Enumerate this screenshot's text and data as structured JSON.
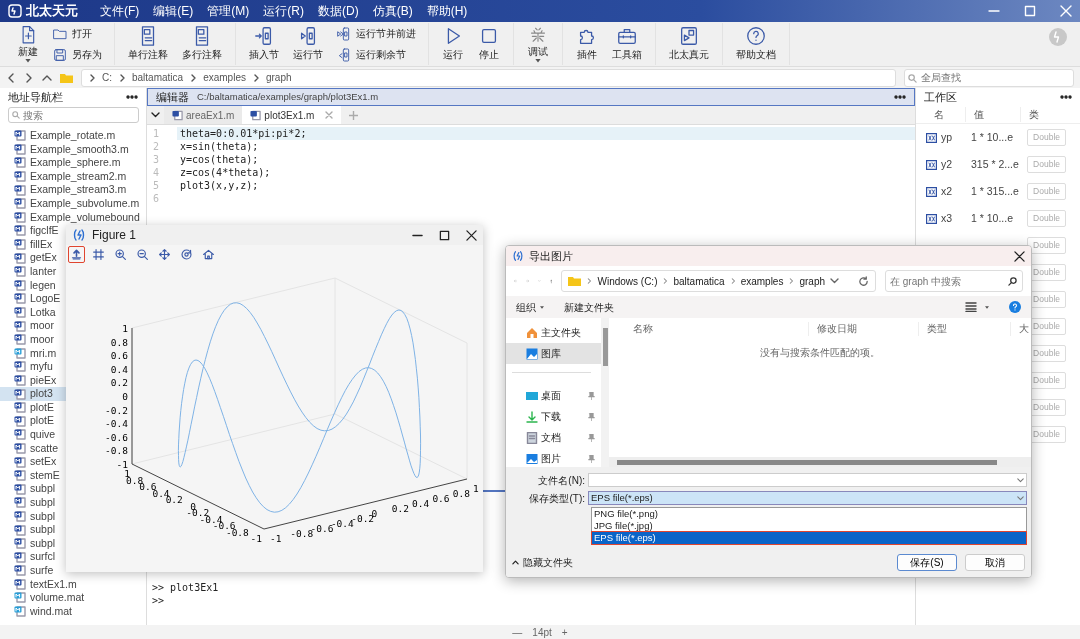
{
  "title_bar": {
    "app_name": "北太天元",
    "menus": [
      "文件(F)",
      "编辑(E)",
      "管理(M)",
      "运行(R)",
      "数据(D)",
      "仿真(B)",
      "帮助(H)"
    ]
  },
  "toolbar": {
    "groups": [
      {
        "items": [
          {
            "kind": "large",
            "label": "新建",
            "dropdown": true
          },
          {
            "kind": "stack",
            "labels": [
              "打开",
              "另存为"
            ]
          }
        ]
      },
      {
        "items": [
          {
            "kind": "large",
            "label": "单行注释",
            "dropdown": false
          },
          {
            "kind": "large",
            "label": "多行注释",
            "dropdown": false
          }
        ]
      },
      {
        "items": [
          {
            "kind": "large",
            "label": "插入节",
            "dropdown": false
          },
          {
            "kind": "large",
            "label": "运行节",
            "dropdown": false
          },
          {
            "kind": "stack",
            "labels": [
              "运行节并前进",
              "运行剩余节"
            ]
          }
        ]
      },
      {
        "items": [
          {
            "kind": "large",
            "label": "运行",
            "dropdown": false
          },
          {
            "kind": "large",
            "label": "停止",
            "dropdown": false
          }
        ]
      },
      {
        "items": [
          {
            "kind": "large",
            "label": "调试",
            "dropdown": true
          }
        ]
      },
      {
        "items": [
          {
            "kind": "large",
            "label": "插件",
            "dropdown": false
          },
          {
            "kind": "large",
            "label": "工具箱",
            "dropdown": false
          }
        ]
      },
      {
        "items": [
          {
            "kind": "large",
            "label": "北太真元",
            "dropdown": false
          }
        ]
      },
      {
        "items": [
          {
            "kind": "large",
            "label": "帮助文档",
            "dropdown": false
          }
        ]
      }
    ]
  },
  "address_bar": {
    "path": [
      "C:",
      "baltamatica",
      "examples",
      "graph"
    ],
    "search_placeholder": "全局查找"
  },
  "navigator": {
    "title": "地址导航栏",
    "search_placeholder": "搜索",
    "files": [
      {
        "name": "Example_rotate.m",
        "kind": "script",
        "selected": false
      },
      {
        "name": "Example_smooth3.m",
        "kind": "script",
        "selected": false
      },
      {
        "name": "Example_sphere.m",
        "kind": "script",
        "selected": false
      },
      {
        "name": "Example_stream2.m",
        "kind": "script",
        "selected": false
      },
      {
        "name": "Example_stream3.m",
        "kind": "script",
        "selected": false
      },
      {
        "name": "Example_subvolume.m",
        "kind": "script",
        "selected": false
      },
      {
        "name": "Example_volumebound",
        "kind": "script",
        "selected": false
      },
      {
        "name": "figclfE",
        "kind": "script",
        "selected": false
      },
      {
        "name": "fillEx",
        "kind": "script",
        "selected": false
      },
      {
        "name": "getEx",
        "kind": "script",
        "selected": false
      },
      {
        "name": "lanter",
        "kind": "script",
        "selected": false
      },
      {
        "name": "legen",
        "kind": "script",
        "selected": false
      },
      {
        "name": "LogoE",
        "kind": "script",
        "selected": false
      },
      {
        "name": "Lotka",
        "kind": "script",
        "selected": false
      },
      {
        "name": "moor",
        "kind": "script",
        "selected": false
      },
      {
        "name": "moor",
        "kind": "script",
        "selected": false
      },
      {
        "name": "mri.m",
        "kind": "data",
        "selected": false
      },
      {
        "name": "myfu",
        "kind": "script",
        "selected": false
      },
      {
        "name": "pieEx",
        "kind": "script",
        "selected": false
      },
      {
        "name": "plot3",
        "kind": "script",
        "selected": true
      },
      {
        "name": "plotE",
        "kind": "script",
        "selected": false
      },
      {
        "name": "plotE",
        "kind": "script",
        "selected": false
      },
      {
        "name": "quive",
        "kind": "script",
        "selected": false
      },
      {
        "name": "scatte",
        "kind": "script",
        "selected": false
      },
      {
        "name": "setEx",
        "kind": "script",
        "selected": false
      },
      {
        "name": "stemE",
        "kind": "script",
        "selected": false
      },
      {
        "name": "subpl",
        "kind": "script",
        "selected": false
      },
      {
        "name": "subpl",
        "kind": "script",
        "selected": false
      },
      {
        "name": "subpl",
        "kind": "script",
        "selected": false
      },
      {
        "name": "subpl",
        "kind": "script",
        "selected": false
      },
      {
        "name": "subpl",
        "kind": "script",
        "selected": false
      },
      {
        "name": "surfcl",
        "kind": "script",
        "selected": false
      },
      {
        "name": "surfe",
        "kind": "script",
        "selected": false
      },
      {
        "name": "textEx1.m",
        "kind": "script",
        "selected": false
      },
      {
        "name": "volume.mat",
        "kind": "data",
        "selected": false
      },
      {
        "name": "wind.mat",
        "kind": "data",
        "selected": false
      }
    ]
  },
  "editor": {
    "title": "编辑器",
    "path": "C:/baltamatica/examples/graph/plot3Ex1.m",
    "tabs": [
      {
        "label": "areaEx1.m",
        "selected": false
      },
      {
        "label": "plot3Ex1.m",
        "selected": true
      }
    ],
    "lines": [
      {
        "number": "1",
        "code": "theta=0:0.01*pi:pi*2;",
        "current": true
      },
      {
        "number": "2",
        "code": "x=sin(theta);",
        "current": false
      },
      {
        "number": "3",
        "code": "y=cos(theta);",
        "current": false
      },
      {
        "number": "4",
        "code": "z=cos(4*theta);",
        "current": false
      },
      {
        "number": "5",
        "code": "plot3(x,y,z);",
        "current": false
      },
      {
        "number": "6",
        "current": false
      }
    ]
  },
  "console": {
    "lines": [
      ">> plot3Ex1",
      ">>"
    ]
  },
  "workspace": {
    "title": "工作区",
    "columns": [
      "名",
      "值",
      "类"
    ],
    "rows": [
      {
        "name": "yp",
        "value": "1 * 10...e",
        "type": "Double"
      },
      {
        "name": "y2",
        "value": "315 * 2...e",
        "type": "Double"
      },
      {
        "name": "x2",
        "value": "1 * 315...e",
        "type": "Double"
      },
      {
        "name": "x3",
        "value": "1 * 10...e",
        "type": "Double"
      },
      {
        "type": "Double"
      },
      {
        "type": "Double"
      },
      {
        "type": "Double"
      },
      {
        "type": "Double"
      },
      {
        "type": "Double"
      },
      {
        "type": "Double"
      },
      {
        "type": "Double"
      },
      {
        "type": "Double"
      }
    ]
  },
  "status_bar": {
    "zoom_out": "—",
    "font_size": "14pt",
    "zoom_in": "+"
  },
  "figure": {
    "title": "Figure 1",
    "tools": [
      {
        "selected": true
      },
      {
        "selected": false
      },
      {
        "selected": false
      },
      {
        "selected": false
      },
      {
        "selected": false
      },
      {
        "selected": false
      },
      {
        "selected": false
      }
    ],
    "plot": {
      "z_ticks": [
        "1",
        "0.8",
        "0.6",
        "0.4",
        "0.2",
        "0",
        "-0.2",
        "-0.4",
        "-0.6",
        "-0.8",
        "-1"
      ],
      "left_ticks": [
        "1",
        "0.8",
        "0.6",
        "0.4",
        "0.2",
        "0",
        "-0.2",
        "-0.4",
        "-0.6",
        "-0.8",
        "-1"
      ],
      "right_ticks": [
        "-1",
        "-0.8",
        "-0.6",
        "-0.4",
        "-0.2",
        "0",
        "0.2",
        "0.4",
        "0.6",
        "0.8",
        "1"
      ]
    }
  },
  "dialog": {
    "title": "导出图片",
    "path": [
      "Windows (C:)",
      "baltamatica",
      "examples",
      "graph"
    ],
    "search_placeholder": "在 graph 中搜索",
    "commands": [
      "组织",
      "新建文件夹"
    ],
    "nav": [
      {
        "label": "主文件夹",
        "selected": false,
        "pinned": false
      },
      {
        "label": "图库",
        "selected": true,
        "pinned": false
      },
      {
        "label": "桌面",
        "selected": false,
        "pinned": true
      },
      {
        "label": "下载",
        "selected": false,
        "pinned": true
      },
      {
        "label": "文档",
        "selected": false,
        "pinned": true
      },
      {
        "label": "图片",
        "selected": false,
        "pinned": true
      }
    ],
    "columns": [
      "名称",
      "修改日期",
      "类型",
      "大"
    ],
    "empty_message": "没有与搜索条件匹配的项。",
    "file_name_label": "文件名(N):",
    "file_type_label": "保存类型(T):",
    "file_type_value": "EPS file(*.eps)",
    "file_type_options": [
      {
        "label": "PNG file(*.png)",
        "selected": false
      },
      {
        "label": "JPG file(*.jpg)",
        "selected": false
      },
      {
        "label": "EPS file(*.eps)",
        "selected": true
      }
    ],
    "hide_folders": "隐藏文件夹",
    "buttons": [
      {
        "label": "保存(S)",
        "default": true
      },
      {
        "label": "取消",
        "default": false
      }
    ]
  }
}
